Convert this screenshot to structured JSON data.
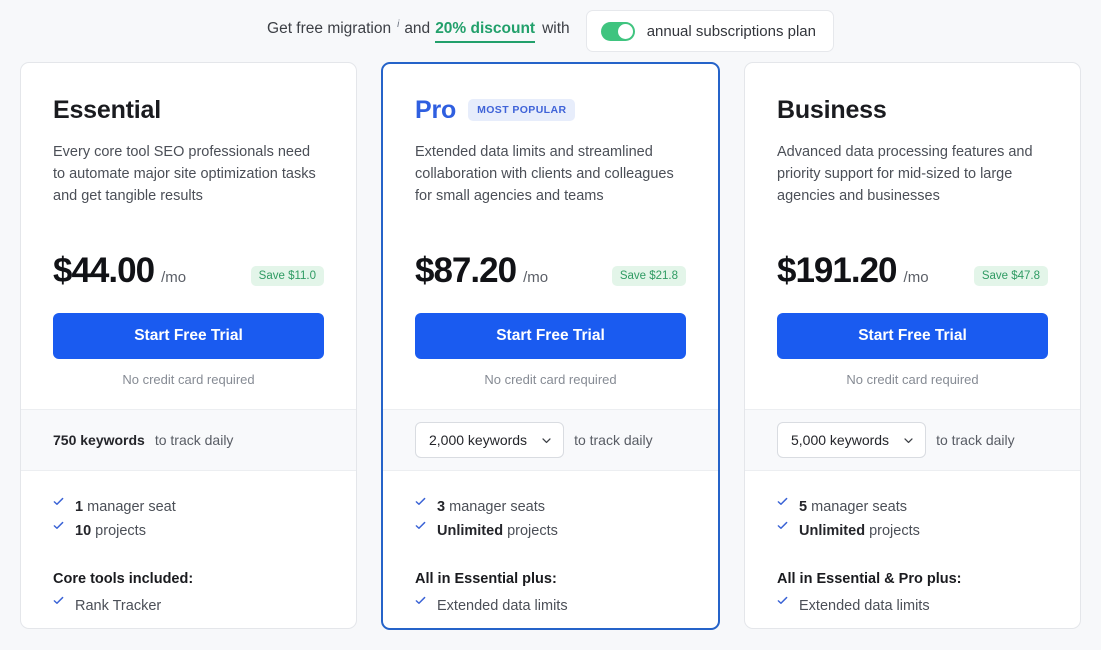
{
  "promo": {
    "lead": "Get free migration",
    "info_marker": "i",
    "and": "and",
    "discount": "20% discount",
    "with": "with",
    "toggle_label": "annual subscriptions plan",
    "toggle_on": true,
    "accent_green": "#22a06b",
    "toggle_green": "#3fc47f"
  },
  "accent_blue": "#1a5bf0",
  "cards": [
    {
      "name": "Essential",
      "badge": "",
      "description": "Every core tool SEO professionals need to automate major site optimization tasks and get tangible results",
      "price": "$44.00",
      "per": "/mo",
      "save": "Save $11.0",
      "cta": "Start Free Trial",
      "cta_note": "No credit card required",
      "keywords_value": "750 keywords",
      "keywords_selectable": false,
      "keywords_suffix": "to track daily",
      "seats": "1",
      "seats_label": "manager seat",
      "projects": "10",
      "projects_label": "projects",
      "group_title": "Core tools included:",
      "group_items": [
        "Rank Tracker"
      ]
    },
    {
      "name": "Pro",
      "badge": "MOST POPULAR",
      "description": "Extended data limits and streamlined collaboration with clients and colleagues for small agencies and teams",
      "price": "$87.20",
      "per": "/mo",
      "save": "Save $21.8",
      "cta": "Start Free Trial",
      "cta_note": "No credit card required",
      "keywords_value": "2,000 keywords",
      "keywords_selectable": true,
      "keywords_suffix": "to track daily",
      "seats": "3",
      "seats_label": "manager seats",
      "projects": "Unlimited",
      "projects_label": "projects",
      "group_title": "All in Essential plus:",
      "group_items": [
        "Extended data limits"
      ]
    },
    {
      "name": "Business",
      "badge": "",
      "description": "Advanced data processing features and priority support for mid-sized to large agencies and businesses",
      "price": "$191.20",
      "per": "/mo",
      "save": "Save $47.8",
      "cta": "Start Free Trial",
      "cta_note": "No credit card required",
      "keywords_value": "5,000 keywords",
      "keywords_selectable": true,
      "keywords_suffix": "to track daily",
      "seats": "5",
      "seats_label": "manager seats",
      "projects": "Unlimited",
      "projects_label": "projects",
      "group_title": "All in Essential & Pro plus:",
      "group_items": [
        "Extended data limits"
      ]
    }
  ],
  "icons": {
    "check": "check-icon",
    "chevron": "chevron-down-icon"
  }
}
